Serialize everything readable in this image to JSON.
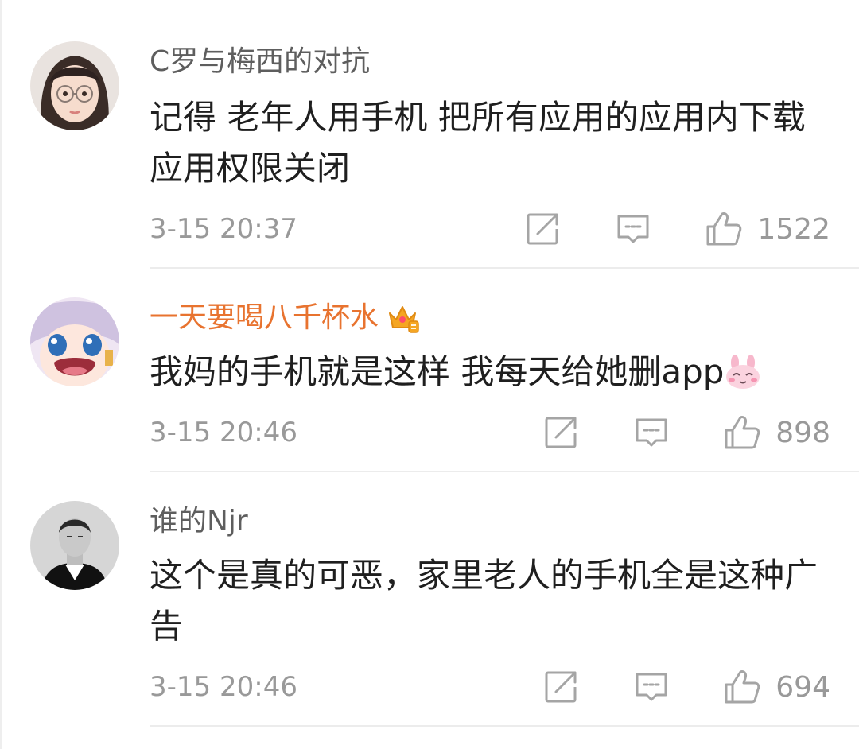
{
  "comments": [
    {
      "username": "C罗与梅西的对抗",
      "text": "记得 老年人用手机 把所有应用的应用内下载应用权限关闭",
      "time": "3-15 20:37",
      "likes": "1522"
    },
    {
      "username": "一天要喝八千杯水",
      "vip": true,
      "badge_icon": "crown-icon",
      "text": "我妈的手机就是这样 我每天给她删app",
      "trailing_emoji": "bunny-emoji-icon",
      "time": "3-15 20:46",
      "likes": "898"
    },
    {
      "username": "谁的Njr",
      "text": "这个是真的可恶，家里老人的手机全是这种广告",
      "time": "3-15 20:46",
      "likes": "694"
    }
  ],
  "colors": {
    "username": "#5e5e5e",
    "vip_username": "#e8732f",
    "body_text": "#1f1f1f",
    "meta": "#999999",
    "divider": "#ececec"
  },
  "icons": {
    "share": "share-icon",
    "reply": "comment-icon",
    "like": "thumbs-up-icon"
  }
}
